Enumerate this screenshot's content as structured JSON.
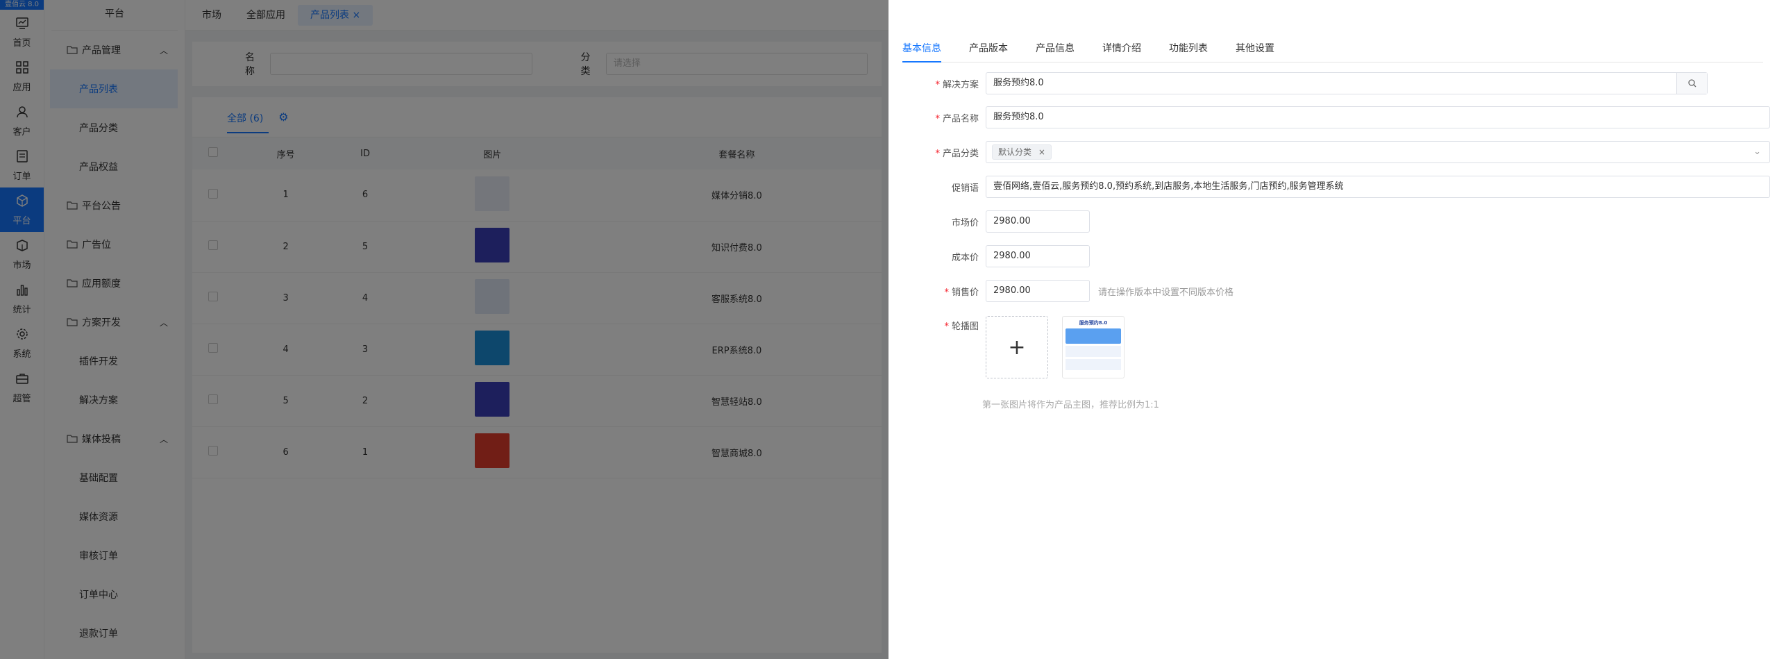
{
  "brand": "壹佰云 8.0",
  "rail": [
    {
      "label": "首页",
      "icon": "dashboard-icon"
    },
    {
      "label": "应用",
      "icon": "apps-icon"
    },
    {
      "label": "客户",
      "icon": "user-icon"
    },
    {
      "label": "订单",
      "icon": "order-icon"
    },
    {
      "label": "平台",
      "icon": "cube-icon",
      "active": true
    },
    {
      "label": "市场",
      "icon": "market-icon"
    },
    {
      "label": "统计",
      "icon": "chart-icon"
    },
    {
      "label": "系统",
      "icon": "gear-icon"
    },
    {
      "label": "超管",
      "icon": "briefcase-icon"
    }
  ],
  "menu": {
    "title": "平台",
    "groups": [
      {
        "label": "产品管理",
        "items": [
          "产品列表",
          "产品分类",
          "产品权益"
        ]
      },
      {
        "label": "平台公告",
        "items": []
      },
      {
        "label": "广告位",
        "items": []
      },
      {
        "label": "应用额度",
        "items": []
      },
      {
        "label": "方案开发",
        "items": [
          "插件开发",
          "解决方案"
        ]
      },
      {
        "label": "媒体投稿",
        "items": [
          "基础配置",
          "媒体资源",
          "审核订单",
          "订单中心",
          "退款订单"
        ]
      }
    ]
  },
  "topTabs": [
    "市场",
    "全部应用",
    "产品列表"
  ],
  "search": {
    "name_label": "名称",
    "category_label": "分类",
    "category_placeholder": "请选择"
  },
  "list": {
    "tab": "全部 (6)",
    "columns": [
      "序号",
      "ID",
      "图片",
      "套餐名称"
    ],
    "rows": [
      {
        "no": "1",
        "id": "6",
        "name": "媒体分销8.0",
        "color": "#e8ecf6"
      },
      {
        "no": "2",
        "id": "5",
        "name": "知识付费8.0",
        "color": "#3a3fb8"
      },
      {
        "no": "3",
        "id": "4",
        "name": "客服系统8.0",
        "color": "#dfe6f4"
      },
      {
        "no": "4",
        "id": "3",
        "name": "ERP系统8.0",
        "color": "#1b8fd8"
      },
      {
        "no": "5",
        "id": "2",
        "name": "智慧轻站8.0",
        "color": "#3a3fb8"
      },
      {
        "no": "6",
        "id": "1",
        "name": "智慧商城8.0",
        "color": "#e23c2c"
      }
    ]
  },
  "drawer": {
    "tabs": [
      "基本信息",
      "产品版本",
      "产品信息",
      "详情介绍",
      "功能列表",
      "其他设置"
    ],
    "solution": {
      "label": "解决方案",
      "value": "服务预约8.0"
    },
    "product_name": {
      "label": "产品名称",
      "value": "服务预约8.0"
    },
    "category": {
      "label": "产品分类",
      "tag": "默认分类"
    },
    "slogan": {
      "label": "促销语",
      "value": "壹佰网络,壹佰云,服务预约8.0,预约系统,到店服务,本地生活服务,门店预约,服务管理系统"
    },
    "market_price": {
      "label": "市场价",
      "value": "2980.00"
    },
    "cost_price": {
      "label": "成本价",
      "value": "2980.00"
    },
    "sale_price": {
      "label": "销售价",
      "value": "2980.00",
      "tip": "请在操作版本中设置不同版本价格"
    },
    "carousel": {
      "label": "轮播图",
      "hint": "第一张图片将作为产品主图，推荐比例为1:1",
      "plus": "+",
      "pic_title": "服务预约8.0"
    }
  }
}
